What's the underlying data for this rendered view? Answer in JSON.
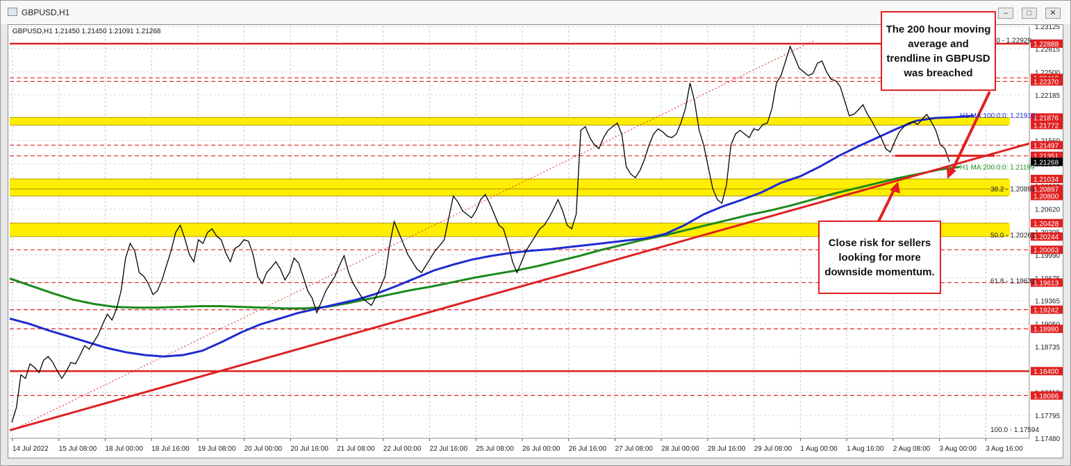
{
  "window": {
    "title": "GBPUSD,H1",
    "buttons": [
      "minimize",
      "maximize",
      "close"
    ]
  },
  "chart_data": {
    "type": "line",
    "symbol_info": "GBPUSD,H1  1.21450 1.21450 1.21091 1.21268",
    "current_price": "1.21268",
    "ylim": [
      1.1748,
      1.23125
    ],
    "y_ticks": [
      "1.23125",
      "1.22815",
      "1.22500",
      "1.22185",
      "1.21870",
      "1.21560",
      "1.21245",
      "1.20935",
      "1.20620",
      "1.20305",
      "1.19990",
      "1.19675",
      "1.19365",
      "1.19050",
      "1.18735",
      "1.18420",
      "1.18110",
      "1.17795",
      "1.17480"
    ],
    "x_ticks": [
      "14 Jul 2022",
      "15 Jul 08:00",
      "18 Jul 00:00",
      "18 Jul 16:00",
      "19 Jul 08:00",
      "20 Jul 00:00",
      "20 Jul 16:00",
      "21 Jul 08:00",
      "22 Jul 00:00",
      "22 Jul 16:00",
      "25 Jul 08:00",
      "26 Jul 00:00",
      "26 Jul 16:00",
      "27 Jul 08:00",
      "28 Jul 00:00",
      "28 Jul 16:00",
      "29 Jul 08:00",
      "1 Aug 00:00",
      "1 Aug 16:00",
      "2 Aug 08:00",
      "3 Aug 00:00",
      "3 Aug 16:00"
    ],
    "price_series": [
      1.177,
      1.179,
      1.1835,
      1.183,
      1.185,
      1.1845,
      1.1838,
      1.1855,
      1.186,
      1.1852,
      1.184,
      1.183,
      1.184,
      1.1852,
      1.185,
      1.1862,
      1.1875,
      1.187,
      1.188,
      1.189,
      1.1905,
      1.1918,
      1.191,
      1.1925,
      1.195,
      1.1995,
      1.2015,
      1.2005,
      1.1975,
      1.197,
      1.196,
      1.1945,
      1.195,
      1.1965,
      1.1985,
      1.2005,
      1.203,
      1.204,
      1.2022,
      1.2,
      1.199,
      1.202,
      1.2015,
      1.203,
      1.2035,
      1.2025,
      1.202,
      1.2002,
      1.199,
      1.2008,
      1.2012,
      1.202,
      1.2018,
      1.2,
      1.197,
      1.196,
      1.1975,
      1.1982,
      1.199,
      1.198,
      1.1965,
      1.1975,
      1.1995,
      1.1988,
      1.197,
      1.195,
      1.194,
      1.192,
      1.1935,
      1.195,
      1.196,
      1.197,
      1.1985,
      1.1998,
      1.1975,
      1.196,
      1.195,
      1.194,
      1.1935,
      1.193,
      1.1942,
      1.1955,
      1.197,
      1.2012,
      1.2045,
      1.203,
      1.2015,
      1.2,
      1.199,
      1.198,
      1.1975,
      1.1985,
      1.1995,
      1.2005,
      1.2012,
      1.202,
      1.205,
      1.208,
      1.2072,
      1.206,
      1.2055,
      1.205,
      1.206,
      1.2075,
      1.2082,
      1.207,
      1.2055,
      1.204,
      1.2035,
      1.2015,
      1.199,
      1.1975,
      1.199,
      1.2005,
      1.2015,
      1.2025,
      1.2035,
      1.204,
      1.205,
      1.2062,
      1.2075,
      1.206,
      1.204,
      1.2035,
      1.2055,
      1.217,
      1.2175,
      1.216,
      1.215,
      1.2145,
      1.216,
      1.217,
      1.2175,
      1.218,
      1.2165,
      1.212,
      1.211,
      1.2105,
      1.2115,
      1.213,
      1.215,
      1.2165,
      1.2172,
      1.2168,
      1.2162,
      1.216,
      1.2165,
      1.218,
      1.22,
      1.2235,
      1.221,
      1.217,
      1.215,
      1.212,
      1.209,
      1.2075,
      1.207,
      1.2095,
      1.215,
      1.2165,
      1.217,
      1.2165,
      1.216,
      1.2172,
      1.217,
      1.2178,
      1.218,
      1.22,
      1.2235,
      1.2245,
      1.2265,
      1.2285,
      1.227,
      1.2255,
      1.225,
      1.2245,
      1.2248,
      1.2262,
      1.2265,
      1.225,
      1.224,
      1.2238,
      1.223,
      1.221,
      1.219,
      1.2192,
      1.2198,
      1.2205,
      1.2192,
      1.2182,
      1.217,
      1.216,
      1.2145,
      1.214,
      1.2155,
      1.2168,
      1.2175,
      1.218,
      1.2182,
      1.2178,
      1.2185,
      1.2192,
      1.2182,
      1.217,
      1.215,
      1.2145,
      1.2127
    ],
    "ma100_series": [
      1.1912,
      1.1905,
      1.1896,
      1.1888,
      1.188,
      1.1872,
      1.1866,
      1.1862,
      1.186,
      1.1862,
      1.1868,
      1.188,
      1.1893,
      1.1904,
      1.1912,
      1.192,
      1.1926,
      1.1932,
      1.1938,
      1.1946,
      1.1956,
      1.1967,
      1.1978,
      1.1986,
      1.1993,
      1.1998,
      1.2002,
      1.2005,
      1.2007,
      1.201,
      1.2013,
      1.2016,
      1.2019,
      1.2022,
      1.2028,
      1.204,
      1.2055,
      1.2066,
      1.2075,
      1.2085,
      1.2098,
      1.2107,
      1.212,
      1.2135,
      1.2148,
      1.216,
      1.2172,
      1.2183,
      1.2187,
      1.2188,
      1.219
    ],
    "ma200_series": [
      1.1967,
      1.1957,
      1.1947,
      1.1938,
      1.1932,
      1.1928,
      1.1927,
      1.1927,
      1.1928,
      1.1929,
      1.1929,
      1.1928,
      1.1927,
      1.1926,
      1.1926,
      1.1928,
      1.1933,
      1.1939,
      1.1945,
      1.1951,
      1.1956,
      1.1962,
      1.1968,
      1.1973,
      1.1978,
      1.1984,
      1.1991,
      1.1998,
      1.2006,
      1.2013,
      1.202,
      1.2026,
      1.2033,
      1.204,
      1.2047,
      1.2054,
      1.206,
      1.2067,
      1.2075,
      1.2083,
      1.209,
      1.2097,
      1.2104,
      1.211,
      1.2116,
      1.212
    ],
    "trendline": {
      "from": 1.1759,
      "to": 1.2152
    },
    "horizontal_levels": [
      {
        "value": "1.22888",
        "style": "solid",
        "color": "#e02020"
      },
      {
        "value": "1.22419",
        "style": "dashed",
        "color": "#e02020"
      },
      {
        "value": "1.22370",
        "style": "dashed",
        "color": "#e02020"
      },
      {
        "value": "1.21876",
        "style": "band",
        "color": "#ffee00"
      },
      {
        "value": "1.21772",
        "style": "band",
        "color": "#ffee00"
      },
      {
        "value": "1.21497",
        "style": "dashed",
        "color": "#e02020"
      },
      {
        "value": "1.21351",
        "style": "dashed",
        "color": "#e02020"
      },
      {
        "value": "1.21034",
        "style": "band",
        "color": "#ffee00"
      },
      {
        "value": "1.20897",
        "style": "band",
        "color": "#ffee00"
      },
      {
        "value": "1.20800",
        "style": "band",
        "color": "#ffee00"
      },
      {
        "value": "1.20428",
        "style": "band",
        "color": "#ffee00"
      },
      {
        "value": "1.20244",
        "style": "band",
        "color": "#ffee00"
      },
      {
        "value": "1.20063",
        "style": "dashed",
        "color": "#e02020"
      },
      {
        "value": "1.19613",
        "style": "dashed",
        "color": "#e02020"
      },
      {
        "value": "1.19242",
        "style": "dashed",
        "color": "#e02020"
      },
      {
        "value": "1.18980",
        "style": "dashed",
        "color": "#e02020"
      },
      {
        "value": "1.18400",
        "style": "solid",
        "color": "#e02020"
      },
      {
        "value": "1.18066",
        "style": "dashed",
        "color": "#e02020"
      }
    ],
    "fib_labels": [
      {
        "label": "0.0 - 1.22929",
        "value": 1.22929
      },
      {
        "label": "38.2 - 1.20891",
        "value": 1.20891
      },
      {
        "label": "50.0 - 1.20261",
        "value": 1.20261
      },
      {
        "label": "61.8 - 1.19632",
        "value": 1.19632
      },
      {
        "label": "100.0 - 1.17594",
        "value": 1.17594
      }
    ],
    "indicator_labels": {
      "ma100": "H1 MA:100:0:0: 1.21910",
      "ma100_value": 1.2191,
      "ma200": "H1 MA:200:0:0: 1.21199",
      "ma200_value": 1.21199
    },
    "colors": {
      "price": "#000000",
      "ma100": "#1f2ad0",
      "ma200": "#1a8a1a",
      "trendline": "#e02020",
      "band": "#ffee00",
      "level": "#e02020"
    }
  },
  "annotations": {
    "top": "The 200 hour moving\naverage and\ntrendline in GBPUSD\nwas breached",
    "bottom": "Close risk for sellers\nlooking for more\ndownside momentum."
  }
}
